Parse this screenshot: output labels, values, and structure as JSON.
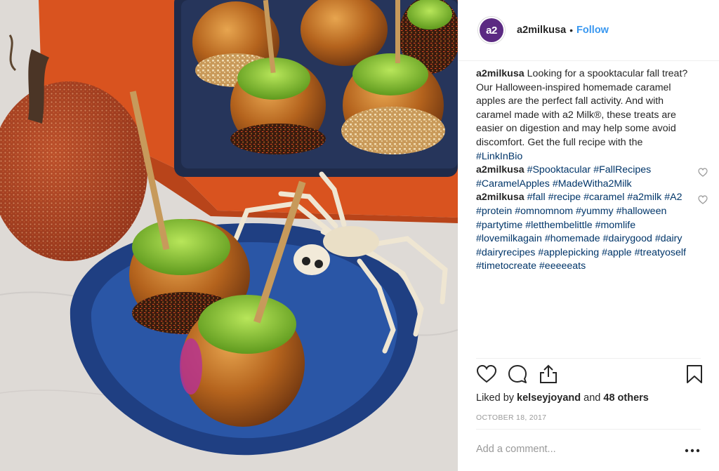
{
  "post": {
    "photo_alt": "Caramel apples on blue plates with a skeleton spider and a glitter pumpkin",
    "author": {
      "username": "a2milkusa",
      "avatar_text": "a2",
      "follow_label": "Follow",
      "separator": "•"
    },
    "comments": [
      {
        "username": "a2milkusa",
        "text": " Looking for a spooktacular fall treat? Our Halloween-inspired homemade caramel apples are the perfect fall activity. And with caramel made with a2 Milk®, these treats are easier on digestion and may help some avoid discomfort. Get the full recipe with the ",
        "tags": [
          "#LinkInBio"
        ],
        "has_like": false
      },
      {
        "username": "a2milkusa",
        "text": " ",
        "tags": [
          "#Spooktacular",
          "#FallRecipes",
          "#CaramelApples",
          "#MadeWitha2Milk"
        ],
        "has_like": true
      },
      {
        "username": "a2milkusa",
        "text": " ",
        "tags": [
          "#fall",
          "#recipe",
          "#caramel",
          "#a2milk",
          "#A2",
          "#protein",
          "#omnomnom",
          "#yummy",
          "#halloween",
          "#partytime",
          "#letthembelittle",
          "#momlife",
          "#lovemilkagain",
          "#homemade",
          "#dairygood",
          "#dairy",
          "#dairyrecipes",
          "#applepicking",
          "#apple",
          "#treatyoself",
          "#timetocreate",
          "#eeeeeats"
        ],
        "has_like": true
      }
    ],
    "likes": {
      "prefix": "Liked by ",
      "user": "kelseyjoyand",
      "joiner": " and ",
      "others": "48 others"
    },
    "date": "OCTOBER 18, 2017",
    "add_comment_placeholder": "Add a comment...",
    "colors": {
      "link_blue": "#3897f0",
      "hashtag": "#003569",
      "muted": "#999999",
      "brand_purple": "#5b2a82"
    },
    "icons": [
      "heart-icon",
      "comment-icon",
      "share-icon",
      "bookmark-icon",
      "more-options-icon"
    ]
  }
}
